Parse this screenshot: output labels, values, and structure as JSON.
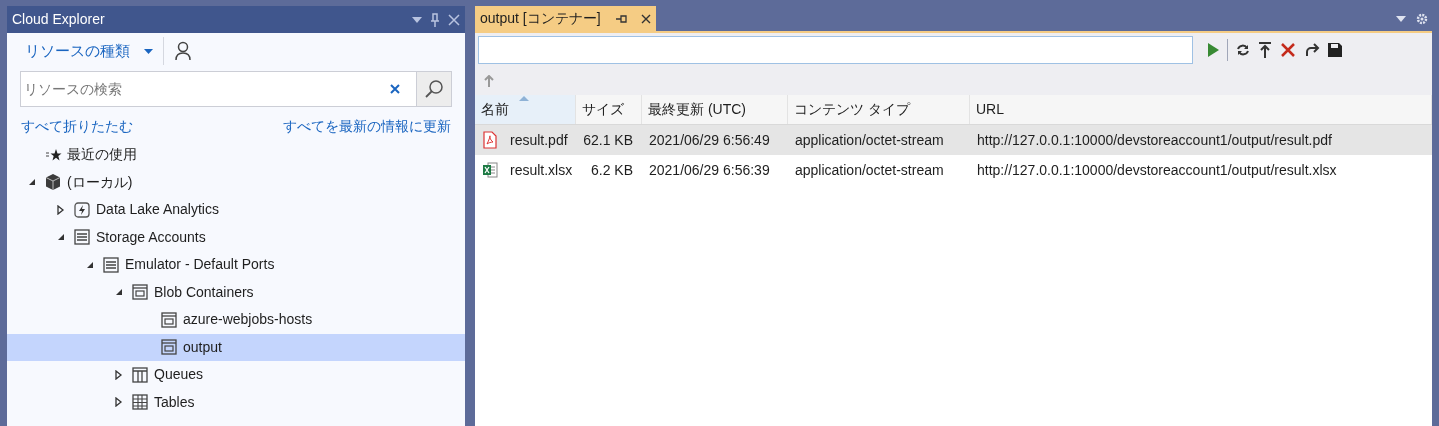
{
  "explorer": {
    "title": "Cloud Explorer",
    "resource_type": "リソースの種類",
    "search": {
      "placeholder": "リソースの検索"
    },
    "collapse_all": "すべて折りたたむ",
    "refresh_all": "すべてを最新の情報に更新",
    "tree": [
      {
        "label": "最近の使用",
        "kind": "recent",
        "selected": false
      },
      {
        "label": "(ローカル)",
        "kind": "local",
        "expanded": true,
        "selected": false,
        "children": [
          {
            "label": "Data Lake Analytics",
            "kind": "analytics",
            "expanded": false,
            "selected": false
          },
          {
            "label": "Storage Accounts",
            "kind": "storage",
            "expanded": true,
            "selected": false,
            "children": [
              {
                "label": "Emulator - Default Ports",
                "kind": "storage",
                "expanded": true,
                "selected": false,
                "children": [
                  {
                    "label": "Blob Containers",
                    "kind": "container",
                    "expanded": true,
                    "selected": false,
                    "children": [
                      {
                        "label": "azure-webjobs-hosts",
                        "kind": "container",
                        "selected": false
                      },
                      {
                        "label": "output",
                        "kind": "container",
                        "selected": true
                      }
                    ]
                  },
                  {
                    "label": "Queues",
                    "kind": "queue",
                    "expanded": false,
                    "selected": false
                  },
                  {
                    "label": "Tables",
                    "kind": "table",
                    "expanded": false,
                    "selected": false
                  }
                ]
              }
            ]
          }
        ]
      }
    ]
  },
  "document": {
    "tab": {
      "title": "output [コンテナー]",
      "selected": true
    },
    "columns": [
      {
        "label": "名前",
        "sorted": true
      },
      {
        "label": "サイズ",
        "sorted": false
      },
      {
        "label": "最終更新 (UTC)",
        "sorted": false
      },
      {
        "label": "コンテンツ タイプ",
        "sorted": false
      },
      {
        "label": "URL",
        "sorted": false
      }
    ],
    "rows": [
      {
        "kind": "pdf",
        "selected": true,
        "cells": [
          "result.pdf",
          "62.1 KB",
          "2021/06/29 6:56:49",
          "application/octet-stream",
          "http://127.0.0.1:10000/devstoreaccount1/output/result.pdf"
        ]
      },
      {
        "kind": "xlsx",
        "selected": false,
        "cells": [
          "result.xlsx",
          "6.2 KB",
          "2021/06/29 6:56:39",
          "application/octet-stream",
          "http://127.0.0.1:10000/devstoreaccount1/output/result.xlsx"
        ]
      }
    ]
  }
}
